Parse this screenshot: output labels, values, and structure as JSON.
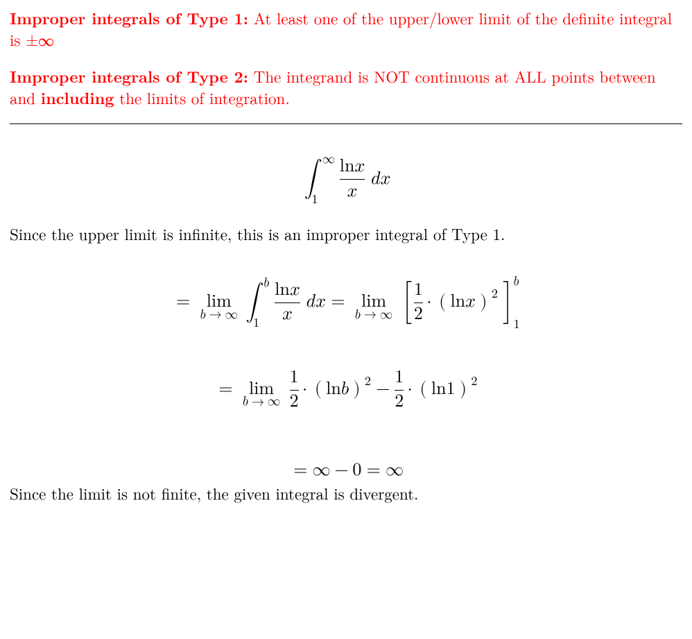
{
  "defs": {
    "type1_title": "Improper integrals of Type 1:",
    "type1_text": " At least one of the upper/lower limit of the definite integral is ±∞",
    "type2_title": "Improper integrals of Type 2:",
    "type2_text_a": " The integrand is NOT continuous at ALL points between and ",
    "type2_bold": "including",
    "type2_text_b": " the limits of integration."
  },
  "body": {
    "classify": "Since the upper limit is infinite, this is an improper integral of Type 1.",
    "conclusion": "Since the limit is not finite, the given integral is divergent."
  },
  "math": {
    "integral_lower": "1",
    "integral_upper": "∞",
    "integrand_num": "ln x",
    "integrand_den": "x",
    "dx": "dx",
    "lim_var": "b",
    "lim_to": "∞",
    "eval_lower": "1",
    "eval_upper": "b",
    "coeff": "1/2",
    "ln1": "ln 1",
    "lnb": "ln b",
    "result_lhs": "∞ − 0",
    "result_rhs": "∞"
  }
}
